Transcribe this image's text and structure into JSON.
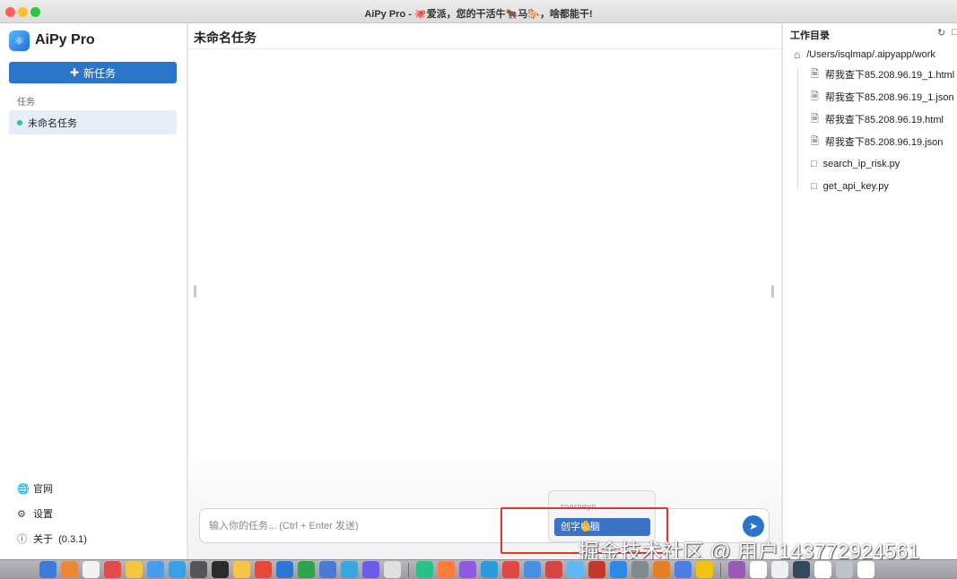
{
  "window": {
    "title": "AiPy Pro - 🐙爱派，您的干活牛🐂马🐎，啥都能干!"
  },
  "sidebar": {
    "app_name": "AiPy Pro",
    "new_task_label": "新任务",
    "section_label": "任务",
    "tasks": [
      {
        "label": "未命名任务"
      }
    ],
    "bottom_links": [
      {
        "label": "官网",
        "icon": "globe-icon"
      },
      {
        "label": "设置",
        "icon": "gear-icon"
      },
      {
        "label": "关于  (0.3.1)",
        "icon": "info-icon"
      }
    ]
  },
  "main": {
    "title": "未命名任务",
    "input_placeholder": "输入你的任务... (Ctrl + Enter 发送)"
  },
  "ime": {
    "composition": "zoorneyo",
    "candidate": "创字电脑"
  },
  "right_panel": {
    "title": "工作目录",
    "root_path": "/Users/isqlmap/.aipyapp/work",
    "files": [
      {
        "name": "帮我查下85.208.96.19_1.html",
        "icon": "document-icon"
      },
      {
        "name": "帮我查下85.208.96.19_1.json",
        "icon": "document-icon"
      },
      {
        "name": "帮我查下85.208.96.19.html",
        "icon": "document-icon"
      },
      {
        "name": "帮我查下85.208.96.19.json",
        "icon": "document-icon"
      },
      {
        "name": "search_ip_risk.py",
        "icon": "python-file-icon"
      },
      {
        "name": "get_api_key.py",
        "icon": "python-file-icon"
      }
    ]
  },
  "watermark": "掘金技术社区 @ 用户143772924561",
  "dock": {
    "colors": [
      "#3d7bd9",
      "#e8893a",
      "#f2f2f2",
      "#e24b4b",
      "#f3c742",
      "#4a9cf0",
      "#39a0e8",
      "#555",
      "#2b2b2b",
      "#f7c548",
      "#e34a3c",
      "#2f76d0",
      "#2ea44f",
      "#4c78d6",
      "#3aa8e0",
      "#6c5ce7",
      "#e0e0e0",
      "#2ac08a",
      "#ff7a3d",
      "#8c5be0",
      "#2d9cdb",
      "#e04848",
      "#4a90e2",
      "#d64545",
      "#5db8f5",
      "#c0392b",
      "#2d89e5",
      "#7f8c8d",
      "#e67e22",
      "#4d7fe0",
      "#f1c40f",
      "#9b59b6",
      "#ffffff",
      "#ecf0f1",
      "#34495e",
      "#ffffff",
      "#bdc3c7",
      "#ffffff"
    ]
  }
}
